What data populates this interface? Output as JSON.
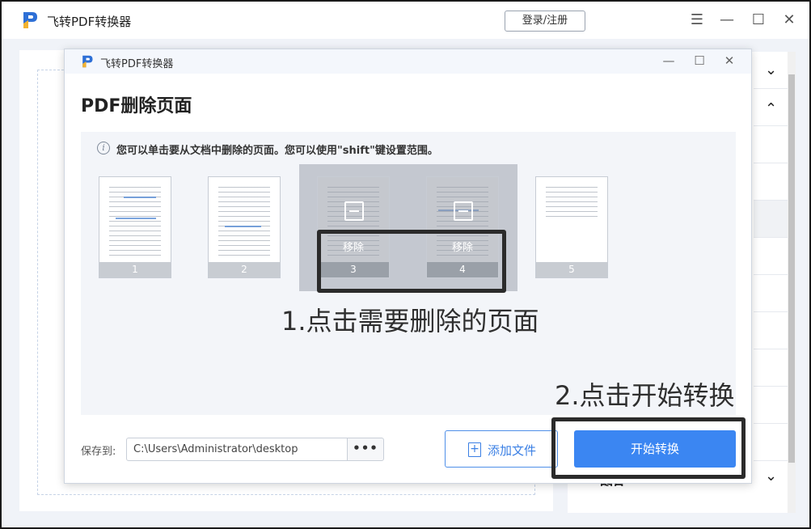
{
  "app": {
    "title": "飞转PDF转换器",
    "login_label": "登录/注册",
    "icons": [
      "menu-icon",
      "minimize-icon",
      "maximize-icon",
      "close-icon"
    ],
    "brand_color": "#3b86f2"
  },
  "background": {
    "partial_text": "图片"
  },
  "dialog": {
    "title": "飞转PDF转换器",
    "heading": "PDF删除页面",
    "hint": "您可以单击要从文档中删除的页面。您可以使用\"shift\"键设置范围。",
    "pages": [
      {
        "num": "1",
        "selected": false
      },
      {
        "num": "2",
        "selected": false
      },
      {
        "num": "3",
        "selected": true
      },
      {
        "num": "4",
        "selected": true
      },
      {
        "num": "5",
        "selected": false
      }
    ],
    "remove_label": "移除",
    "save_label": "保存到:",
    "save_path": "C:\\Users\\Administrator\\desktop",
    "browse_label": "•••",
    "add_file_label": "添加文件",
    "start_label": "开始转换"
  },
  "annotations": {
    "step1": "1.点击需要删除的页面",
    "step2": "2.点击开始转换"
  }
}
